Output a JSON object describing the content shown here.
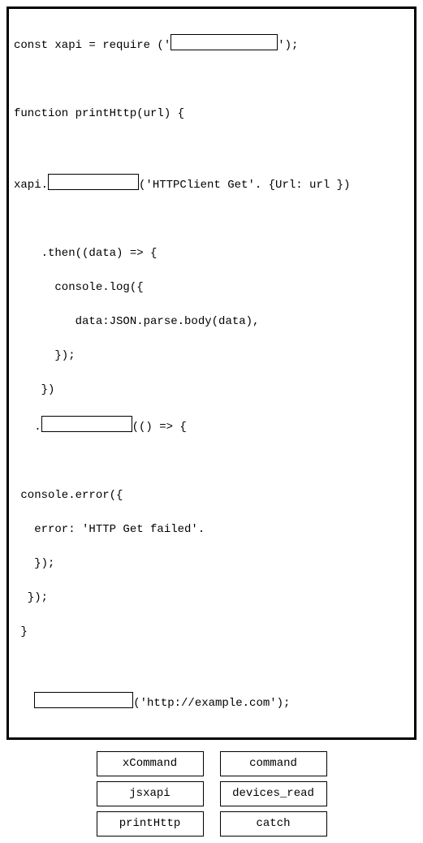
{
  "code": {
    "l1a": "const xapi = require ('",
    "l1b": "');",
    "l3": "function printHttp(url) {",
    "l5a": "xapi.",
    "l5b": "('HTTPClient Get'. {Url: url })",
    "l7": "    .then((data) => {",
    "l8": "      console.log({",
    "l9": "         data:JSON.parse.body(data),",
    "l10": "      });",
    "l11": "    })",
    "l12a": "   .",
    "l12b": "(() => {",
    "l14": " console.error({",
    "l15": "   error: 'HTTP Get failed'.",
    "l16": "   });",
    "l17": "  });",
    "l18": " }",
    "l20a": "   ",
    "l20b": "('http://example.com');"
  },
  "options": {
    "r1c1": "xCommand",
    "r1c2": "command",
    "r2c1": "jsxapi",
    "r2c2": "devices_read",
    "r3c1": "printHttp",
    "r3c2": "catch"
  }
}
